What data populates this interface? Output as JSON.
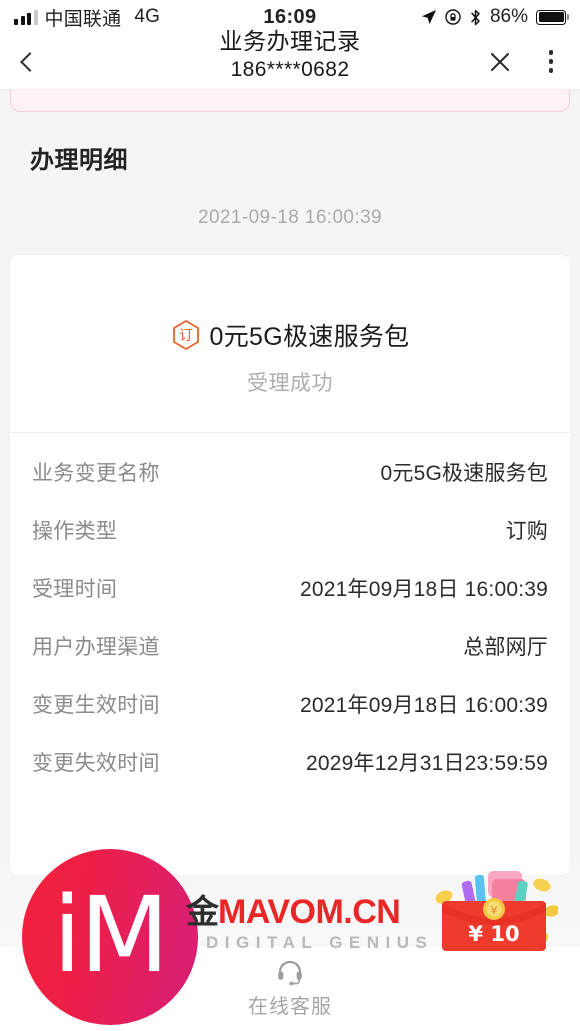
{
  "status_bar": {
    "carrier": "中国联通",
    "network": "4G",
    "time": "16:09",
    "battery_percent": "86%",
    "icons": [
      "signal-bars-icon",
      "location-arrow-icon",
      "rotation-lock-icon",
      "bluetooth-icon",
      "battery-icon"
    ]
  },
  "nav_bar": {
    "back_icon": "chevron-left-icon",
    "title": "业务办理记录",
    "subtitle": "186****0682",
    "close_icon": "close-icon",
    "menu_icon": "more-vertical-icon"
  },
  "page": {
    "section_title": "办理明细",
    "record_time": "2021-09-18 16:00:39"
  },
  "card": {
    "badge_icon": "order-hexagon-icon",
    "badge_text": "订",
    "product_name": "0元5G极速服务包",
    "status": "受理成功",
    "rows": [
      {
        "label": "业务变更名称",
        "value": "0元5G极速服务包"
      },
      {
        "label": "操作类型",
        "value": "订购"
      },
      {
        "label": "受理时间",
        "value": "2021年09月18日 16:00:39"
      },
      {
        "label": "用户办理渠道",
        "value": "总部网厅"
      },
      {
        "label": "变更生效时间",
        "value": "2021年09月18日 16:00:39"
      },
      {
        "label": "变更失效时间",
        "value": "2029年12月31日23:59:59"
      }
    ]
  },
  "service_bar": {
    "icon": "headset-icon",
    "label": "在线客服"
  },
  "watermark": {
    "logo_text": "iM",
    "brand_cn": "金",
    "brand_latin": "MAVOM.CN",
    "tagline": "DIGITAL GENIUS",
    "packet_amount": "¥10",
    "packet_icon": "red-envelope-icon"
  },
  "colors": {
    "accent_orange": "#e8642a",
    "brand_red": "#ea2727",
    "logo_gradient_start": "#f4213b",
    "logo_gradient_end": "#d61f77",
    "banner_border": "#f3cfd5",
    "banner_fill": "#fdf2f4"
  }
}
